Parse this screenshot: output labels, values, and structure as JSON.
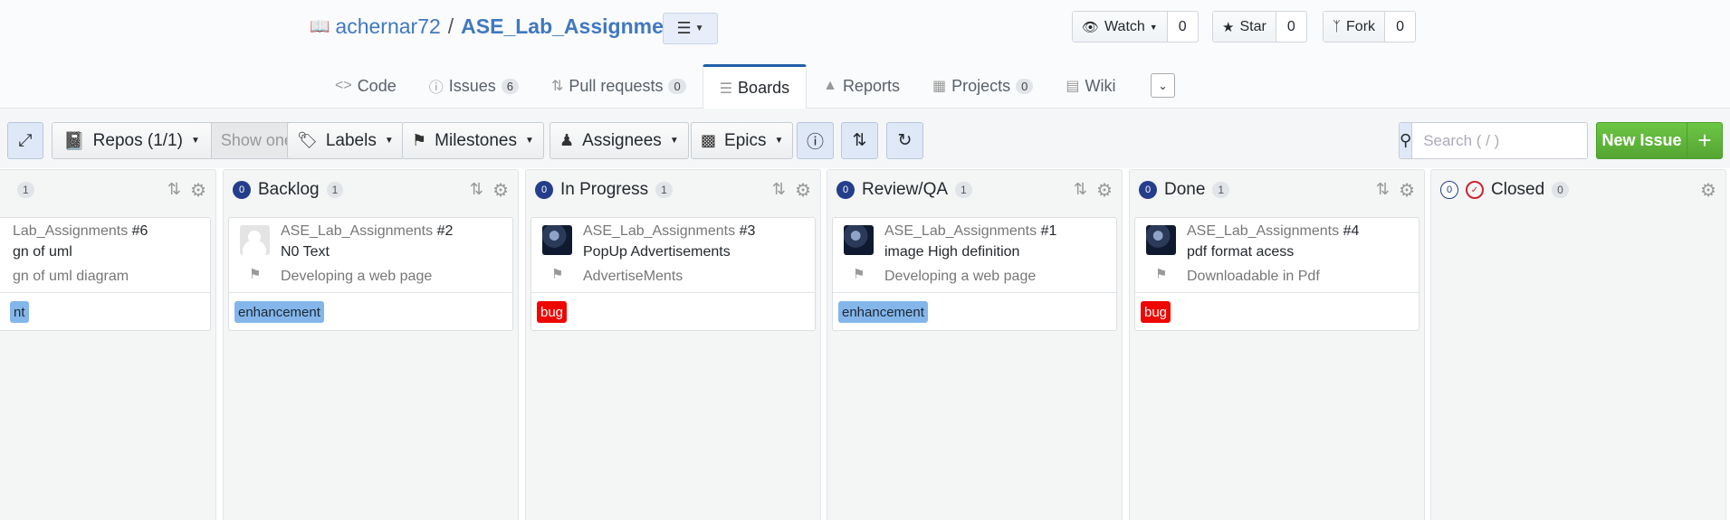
{
  "repo": {
    "owner": "achernar72",
    "separator": "/",
    "name": "ASE_Lab_Assignments"
  },
  "social": {
    "watch_label": "Watch",
    "watch_count": "0",
    "star_label": "Star",
    "star_count": "0",
    "fork_label": "Fork",
    "fork_count": "0"
  },
  "tabs": [
    {
      "label": "Code",
      "badge": ""
    },
    {
      "label": "Issues",
      "badge": "6"
    },
    {
      "label": "Pull requests",
      "badge": "0"
    },
    {
      "label": "Boards",
      "badge": ""
    },
    {
      "label": "Reports",
      "badge": ""
    },
    {
      "label": "Projects",
      "badge": "0"
    },
    {
      "label": "Wiki",
      "badge": ""
    }
  ],
  "active_tab": "Boards",
  "toolbar": {
    "repos_label": "Repos (1/1)",
    "show_one": "Show one",
    "labels": "Labels",
    "milestones": "Milestones",
    "assignees": "Assignees",
    "epics": "Epics",
    "search_placeholder": "Search ( / )",
    "new_issue": "New Issue",
    "new_issue_plus": "+"
  },
  "columns": [
    {
      "title": "",
      "badge": "1",
      "circle": "",
      "card": {
        "repo": "Lab_Assignments",
        "number": "#6",
        "title": "gn of uml",
        "milestone": "gn of uml diagram",
        "label": "nt",
        "label_type": "enh",
        "avatar": "photo"
      }
    },
    {
      "title": "Backlog",
      "badge": "1",
      "circle": "0",
      "card": {
        "repo": "ASE_Lab_Assignments",
        "number": "#2",
        "title": "N0 Text",
        "milestone": "Developing a web page",
        "label": "enhancement",
        "label_type": "enh",
        "avatar": "default"
      }
    },
    {
      "title": "In Progress",
      "badge": "1",
      "circle": "0",
      "card": {
        "repo": "ASE_Lab_Assignments",
        "number": "#3",
        "title": "PopUp Advertisements",
        "milestone": "AdvertiseMents",
        "label": "bug",
        "label_type": "bug",
        "avatar": "photo"
      }
    },
    {
      "title": "Review/QA",
      "badge": "1",
      "circle": "0",
      "card": {
        "repo": "ASE_Lab_Assignments",
        "number": "#1",
        "title": "image High definition",
        "milestone": "Developing a web page",
        "label": "enhancement",
        "label_type": "enh",
        "avatar": "photo"
      }
    },
    {
      "title": "Done",
      "badge": "1",
      "circle": "0",
      "card": {
        "repo": "ASE_Lab_Assignments",
        "number": "#4",
        "title": "pdf format acess",
        "milestone": "Downloadable in Pdf",
        "label": "bug",
        "label_type": "bug",
        "avatar": "photo"
      }
    },
    {
      "title": "Closed",
      "badge": "0",
      "circle": "0"
    }
  ],
  "colors": {
    "accent": "#4078c0",
    "green": "#6cc644",
    "bug": "#ee0701",
    "enhancement": "#84b6eb",
    "column_circle": "#253e8b"
  }
}
